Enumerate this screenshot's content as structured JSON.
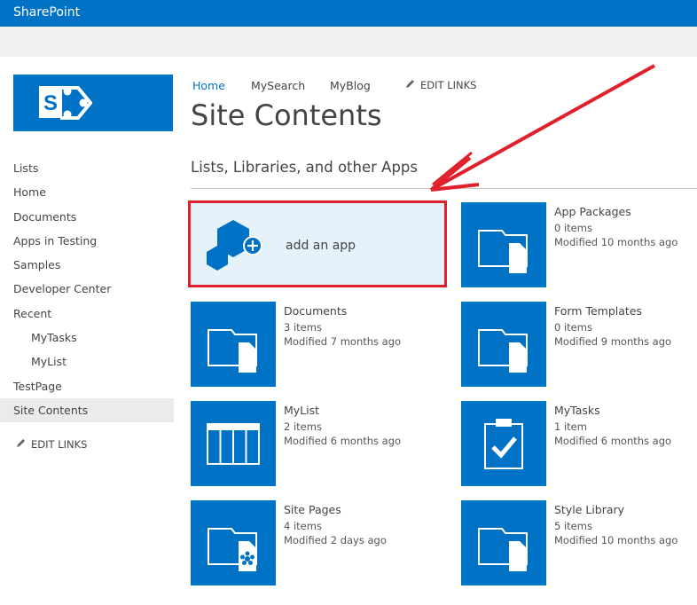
{
  "suite_bar": {
    "brand": "SharePoint"
  },
  "colors": {
    "accent": "#0072c6",
    "highlight": "#e0202b",
    "addapp_bg": "#e6f2fa"
  },
  "top_nav": {
    "items": [
      "Home",
      "MyBlog",
      "MySearch"
    ],
    "edit_links": "EDIT LINKS"
  },
  "left_nav": {
    "items": [
      {
        "label": "Lists"
      },
      {
        "label": "Home"
      },
      {
        "label": "Documents"
      },
      {
        "label": "Apps in Testing"
      },
      {
        "label": "Samples"
      },
      {
        "label": "Developer Center"
      },
      {
        "label": "Recent"
      },
      {
        "label": "MyTasks"
      },
      {
        "label": "MyList"
      },
      {
        "label": "TestPage"
      },
      {
        "label": "Site Contents"
      }
    ],
    "edit_links": "EDIT LINKS"
  },
  "page": {
    "title": "Site Contents",
    "section_title": "Lists, Libraries, and other Apps"
  },
  "add_app": {
    "label": "add an app",
    "icon": "add-app-icon"
  },
  "tiles": [
    {
      "name": "App Packages",
      "items": "0 items",
      "modified": "Modified 10 months ago",
      "icon": "folder-icon"
    },
    {
      "name": "Documents",
      "items": "3 items",
      "modified": "Modified 7 months ago",
      "icon": "folder-icon"
    },
    {
      "name": "Form Templates",
      "items": "0 items",
      "modified": "Modified 9 months ago",
      "icon": "folder-icon"
    },
    {
      "name": "MyList",
      "items": "2 items",
      "modified": "Modified 6 months ago",
      "icon": "list-grid-icon"
    },
    {
      "name": "MyTasks",
      "items": "1 item",
      "modified": "Modified 6 months ago",
      "icon": "task-clipboard-icon"
    },
    {
      "name": "Site Pages",
      "items": "4 items",
      "modified": "Modified 2 days ago",
      "icon": "site-pages-icon"
    },
    {
      "name": "Style Library",
      "items": "5 items",
      "modified": "Modified 10 months ago",
      "icon": "folder-icon"
    }
  ]
}
